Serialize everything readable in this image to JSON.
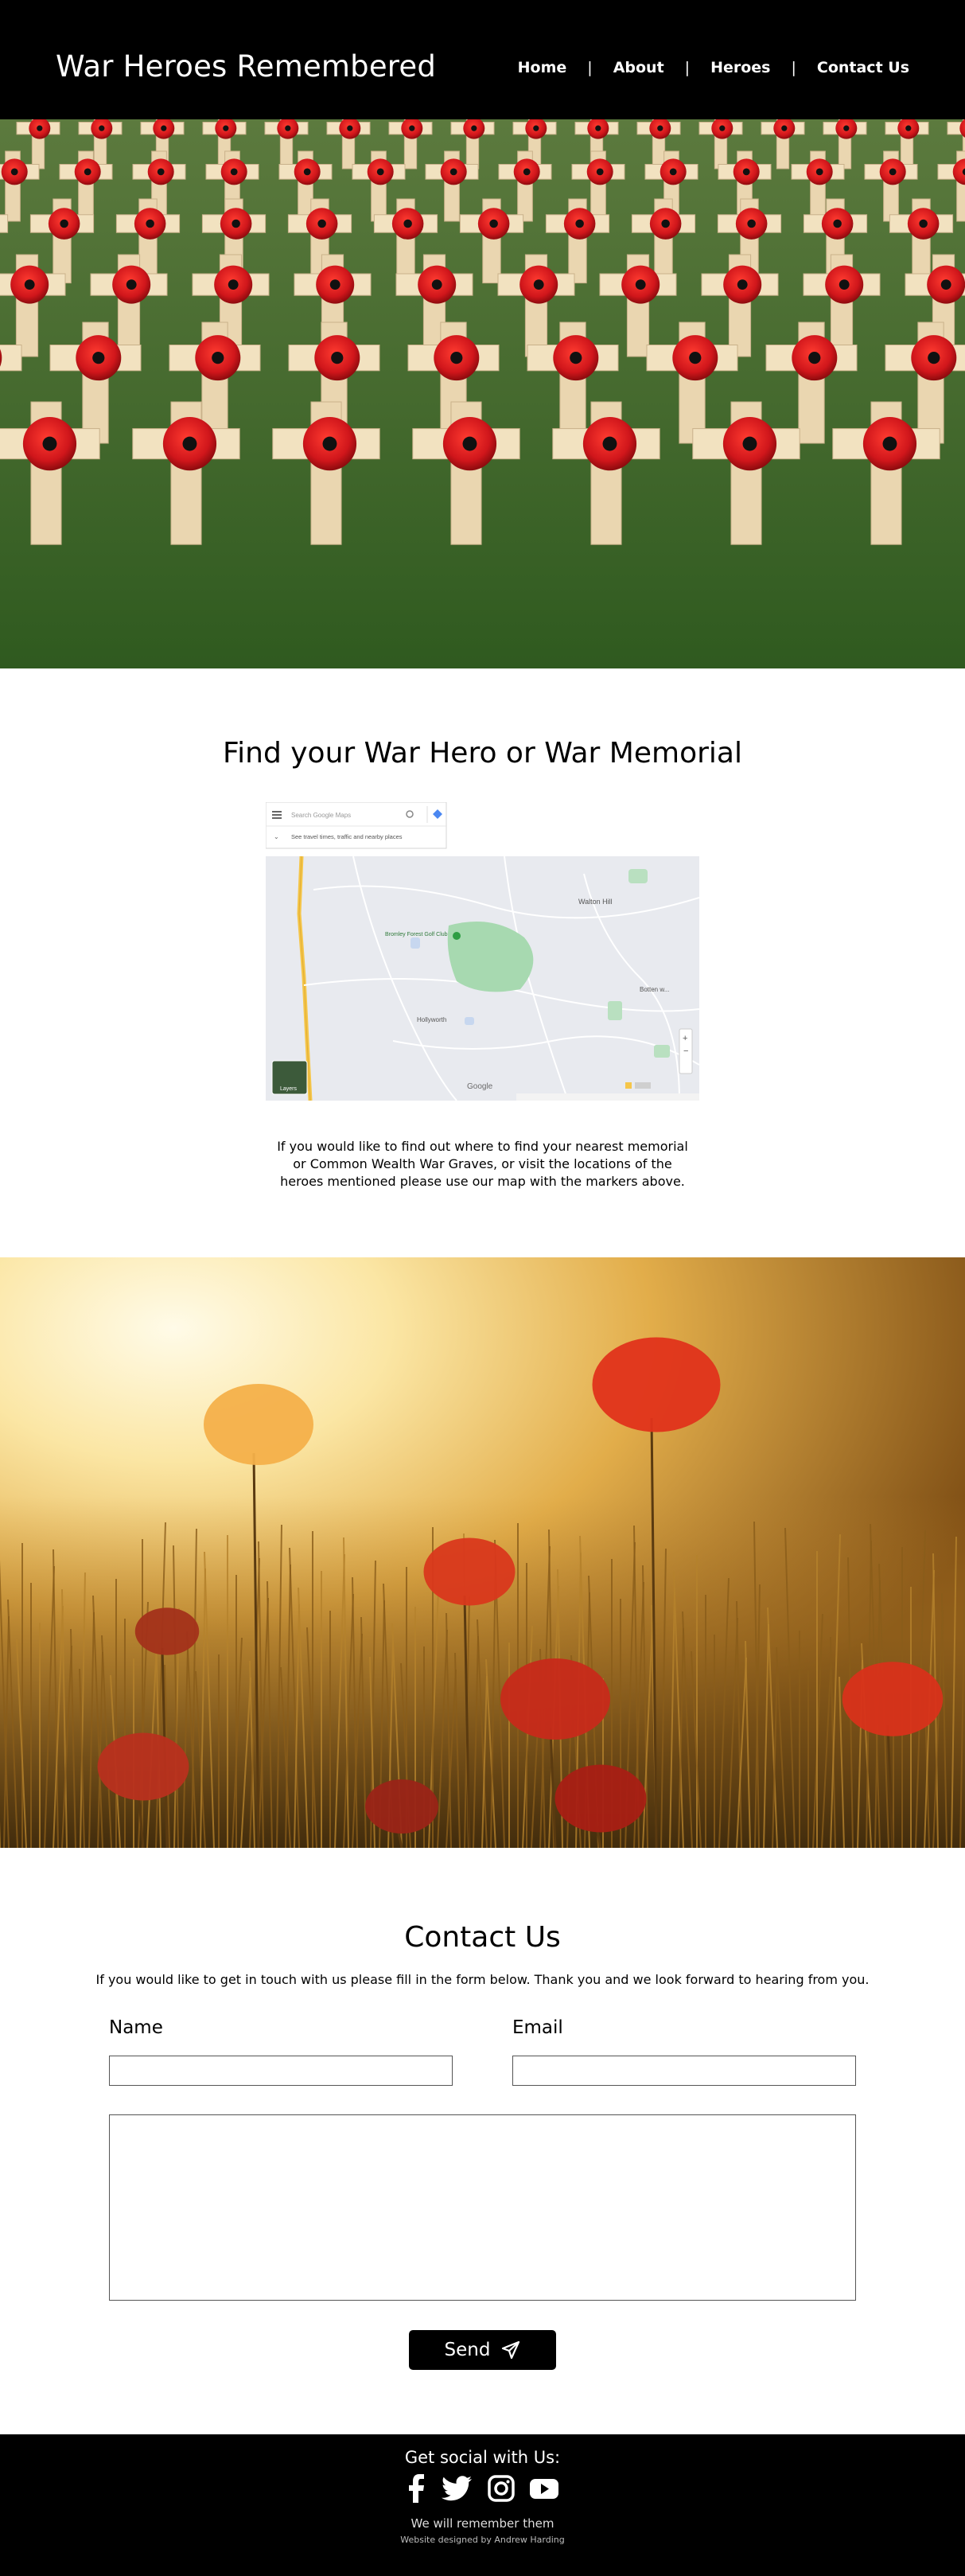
{
  "header": {
    "title": "War Heroes Remembered",
    "nav": [
      "Home",
      "About",
      "Heroes",
      "Contact Us"
    ]
  },
  "find": {
    "title": "Find your War Hero or War Memorial",
    "map": {
      "search_placeholder": "Search Google Maps",
      "travel_text": "See travel times, traffic and nearby places",
      "places": [
        "Walton Hill",
        "Bromley Forest Golf Club",
        "Hollyworth",
        "Botten w..."
      ],
      "layers_label": "Layers",
      "brand": "Google"
    },
    "text": "If you would like to find out where to find your nearest memorial or Common Wealth War Graves, or visit the locations of the heroes mentioned please use our map with the markers above."
  },
  "contact": {
    "title": "Contact Us",
    "intro": "If you would like to get in touch with us please fill in the form below. Thank you and we look forward to hearing from you.",
    "name_label": "Name",
    "email_label": "Email",
    "send_label": "Send"
  },
  "footer": {
    "social_title": "Get social with Us:",
    "icons": [
      "facebook-icon",
      "twitter-icon",
      "instagram-icon",
      "youtube-icon"
    ],
    "tagline": "We will remember them",
    "credit": "Website designed by Andrew Harding"
  },
  "colors": {
    "header_bg": "#000000",
    "poppy_red": "#d0161b",
    "grass": "#3f6a2e",
    "field_gold": "#c28a2a"
  }
}
